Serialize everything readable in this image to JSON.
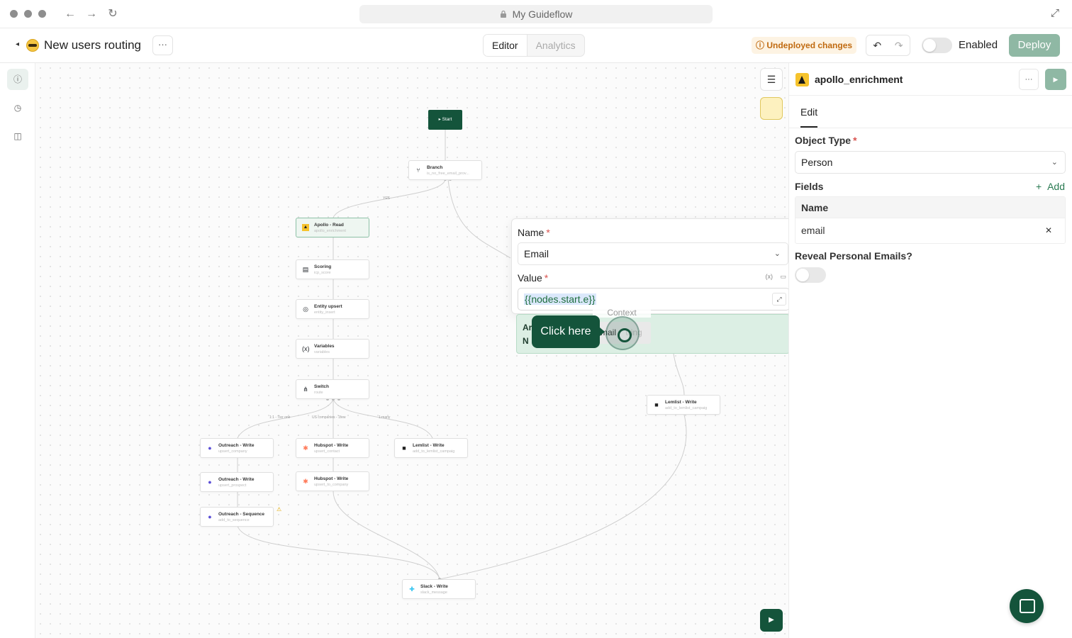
{
  "browser": {
    "url_title": "My Guideflow",
    "icons": [
      "close-dot",
      "minimize-dot",
      "maximize-dot",
      "back-icon",
      "forward-icon",
      "reload-icon",
      "lock-icon",
      "expand-icon"
    ]
  },
  "header": {
    "title": "New users routing",
    "more_label": "···",
    "tabs": [
      {
        "label": "Editor",
        "active": true
      },
      {
        "label": "Analytics",
        "active": false
      }
    ],
    "status_badge": "Undeployed changes",
    "enabled_label": "Enabled",
    "enabled": false,
    "deploy_label": "Deploy",
    "accent_color": "#14543b"
  },
  "sidebar": {
    "items": [
      {
        "icon": "info-icon"
      },
      {
        "icon": "history-icon"
      },
      {
        "icon": "panel-icon"
      }
    ]
  },
  "canvas": {
    "start_label": "Start",
    "nodes": [
      {
        "title": "Branch",
        "subtitle": "is_no_free_email_prov..."
      },
      {
        "title": "Apollo - Read",
        "subtitle": "apollo_enrichment"
      },
      {
        "title": "Scoring",
        "subtitle": "icp_score"
      },
      {
        "title": "Entity upsert",
        "subtitle": "entity_insert"
      },
      {
        "title": "Variables",
        "subtitle": "variables"
      },
      {
        "title": "Switch",
        "subtitle": "route"
      },
      {
        "title": "Outreach - Write",
        "subtitle": "upsert_company"
      },
      {
        "title": "Hubspot - Write",
        "subtitle": "upsert_contact"
      },
      {
        "title": "Lemlist - Write",
        "subtitle": "add_to_lemlist_campaig"
      },
      {
        "title": "Outreach - Write",
        "subtitle": "upsert_prospect"
      },
      {
        "title": "Hubspot - Write",
        "subtitle": "upsert_to_company"
      },
      {
        "title": "Outreach - Sequence",
        "subtitle": "add_to_sequence"
      },
      {
        "title": "Lemlist - Write",
        "subtitle": "add_to_lemlist_campaig"
      },
      {
        "title": "Slack - Write",
        "subtitle": "slack_message"
      }
    ],
    "edge_labels": {
      "yes": "YES",
      "tier": "1:1 - Tier one",
      "us": "US companies - 1few",
      "many": "1:many"
    }
  },
  "popover": {
    "name_label": "Name",
    "name_value": "Email",
    "value_label": "Value",
    "var_icon": "(x)",
    "value_text": "{{nodes.start.e}}",
    "context_label": "Context",
    "suggest_line1": "Ar",
    "suggest_line2": "N",
    "suggest_key": "mail",
    "suggest_type": "tring"
  },
  "tooltip": {
    "label": "Click here"
  },
  "panel": {
    "node_title": "apollo_enrichment",
    "more_label": "···",
    "tab": "Edit",
    "object_type_label": "Object Type",
    "object_type_value": "Person",
    "fields_label": "Fields",
    "add_label": "Add",
    "table_header": "Name",
    "rows": [
      "email"
    ],
    "reveal_label": "Reveal Personal Emails?",
    "reveal_enabled": false
  }
}
